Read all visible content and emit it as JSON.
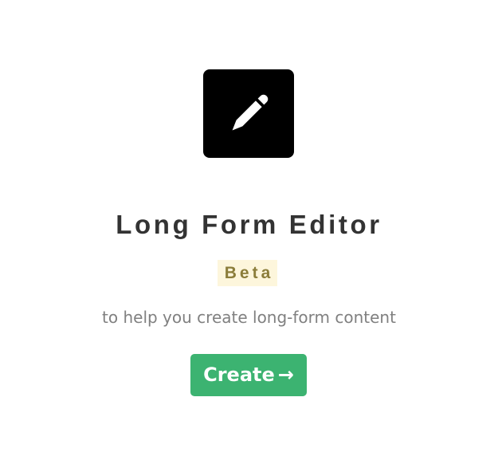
{
  "app": {
    "logo_icon": "pencil-icon",
    "title": "Long Form Editor",
    "badge": "Beta",
    "subtitle": "to help you create long-form content"
  },
  "actions": {
    "create_label": "Create",
    "create_icon": "→"
  },
  "colors": {
    "logo_background": "#000000",
    "title_text": "#333333",
    "badge_background": "#fdf6dc",
    "badge_text": "#8b7d3a",
    "subtitle_text": "#808080",
    "button_background": "#3cb371",
    "button_text": "#ffffff"
  }
}
